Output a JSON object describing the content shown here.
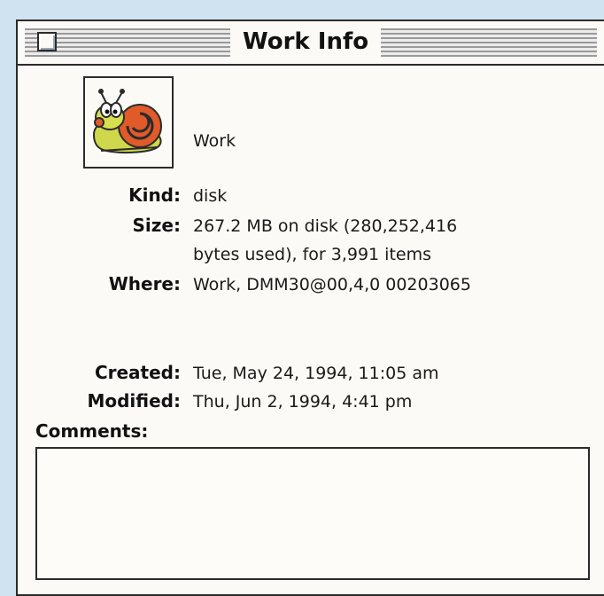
{
  "window": {
    "title": "Work Info"
  },
  "disk": {
    "name": "Work",
    "icon": "snail-disk-icon"
  },
  "info": {
    "kind_label": "Kind:",
    "kind_value": "disk",
    "size_label": "Size:",
    "size_value_line1": "267.2 MB on disk (280,252,416",
    "size_value_line2": "bytes used), for 3,991 items",
    "where_label": "Where:",
    "where_value": "Work, DMM30@00,4,0 00203065",
    "created_label": "Created:",
    "created_value": "Tue, May 24, 1994, 11:05 am",
    "modified_label": "Modified:",
    "modified_value": "Thu, Jun 2, 1994, 4:41 pm",
    "comments_label": "Comments:",
    "comments_value": ""
  },
  "colors": {
    "background": "#cfe3f0",
    "window": "#fbfaf6",
    "border": "#2b2b2b"
  }
}
